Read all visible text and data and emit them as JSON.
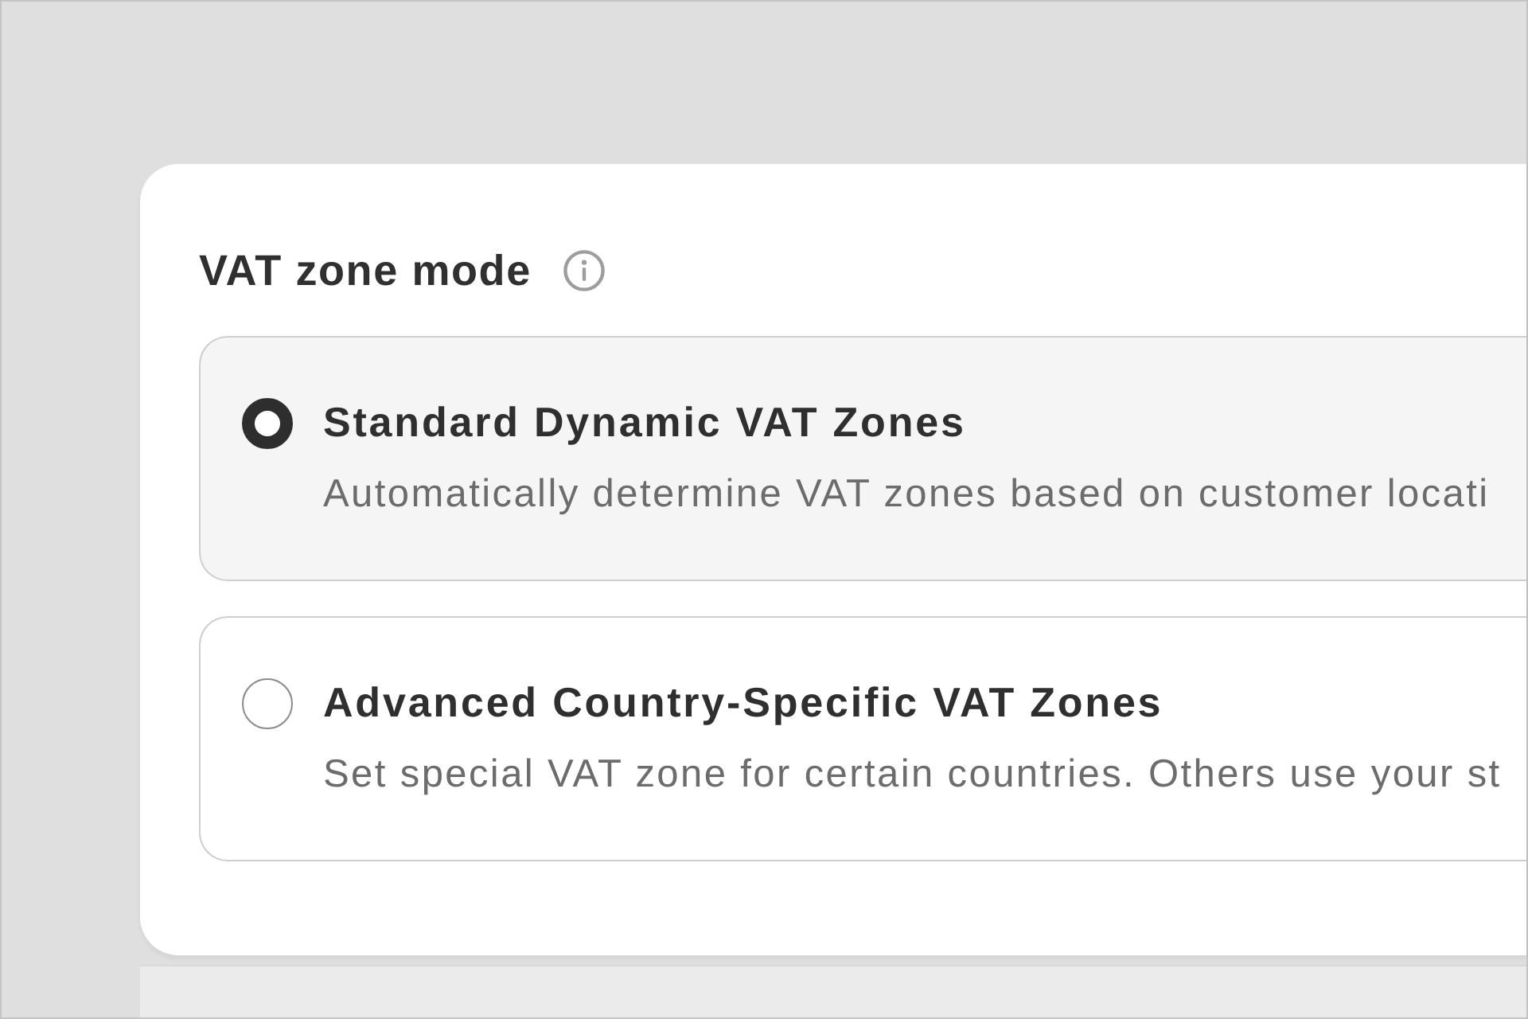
{
  "vat_zone_mode": {
    "label": "VAT zone mode",
    "options": [
      {
        "title": "Standard Dynamic VAT Zones",
        "description": "Automatically determine VAT zones based on customer locati",
        "selected": true
      },
      {
        "title": "Advanced Country-Specific VAT Zones",
        "description": "Set special VAT zone for certain countries. Others use your st",
        "selected": false
      }
    ]
  }
}
